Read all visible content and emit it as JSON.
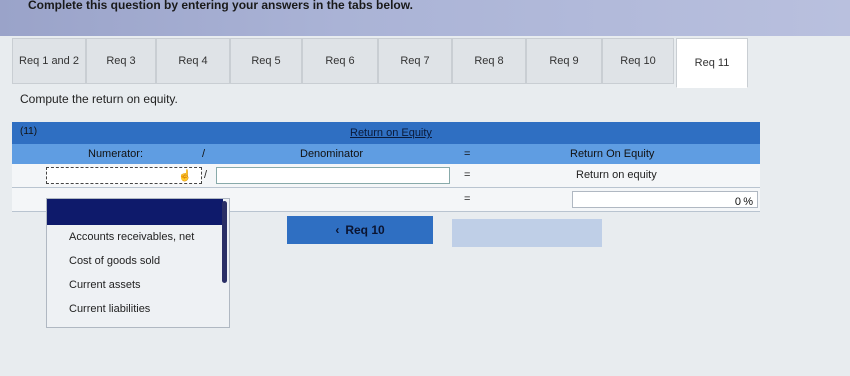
{
  "banner": {
    "title": "Complete this question by entering your answers in the tabs below."
  },
  "tabs": [
    {
      "label": "Req 1 and 2"
    },
    {
      "label": "Req 3"
    },
    {
      "label": "Req 4"
    },
    {
      "label": "Req 5"
    },
    {
      "label": "Req 6"
    },
    {
      "label": "Req 7"
    },
    {
      "label": "Req 8"
    },
    {
      "label": "Req 9"
    },
    {
      "label": "Req 10"
    },
    {
      "label": "Req 11"
    }
  ],
  "instruction": "Compute the return on equity.",
  "table": {
    "id_label": "(11)",
    "title": "Return on Equity",
    "col_numerator": "Numerator:",
    "col_slash": "/",
    "col_denominator": "Denominator",
    "col_equals": "=",
    "col_result": "Return On Equity",
    "row1_slash": "/",
    "row1_equals": "=",
    "row1_result": "Return on equity",
    "row2_equals": "=",
    "row2_value": "0",
    "row2_pct": "%"
  },
  "dropdown": {
    "items": [
      "Accounts receivables, net",
      "Cost of goods sold",
      "Current assets",
      "Current liabilities"
    ]
  },
  "nav": {
    "prev_label": "Req 10",
    "prev_icon": "chevron-left-icon"
  }
}
